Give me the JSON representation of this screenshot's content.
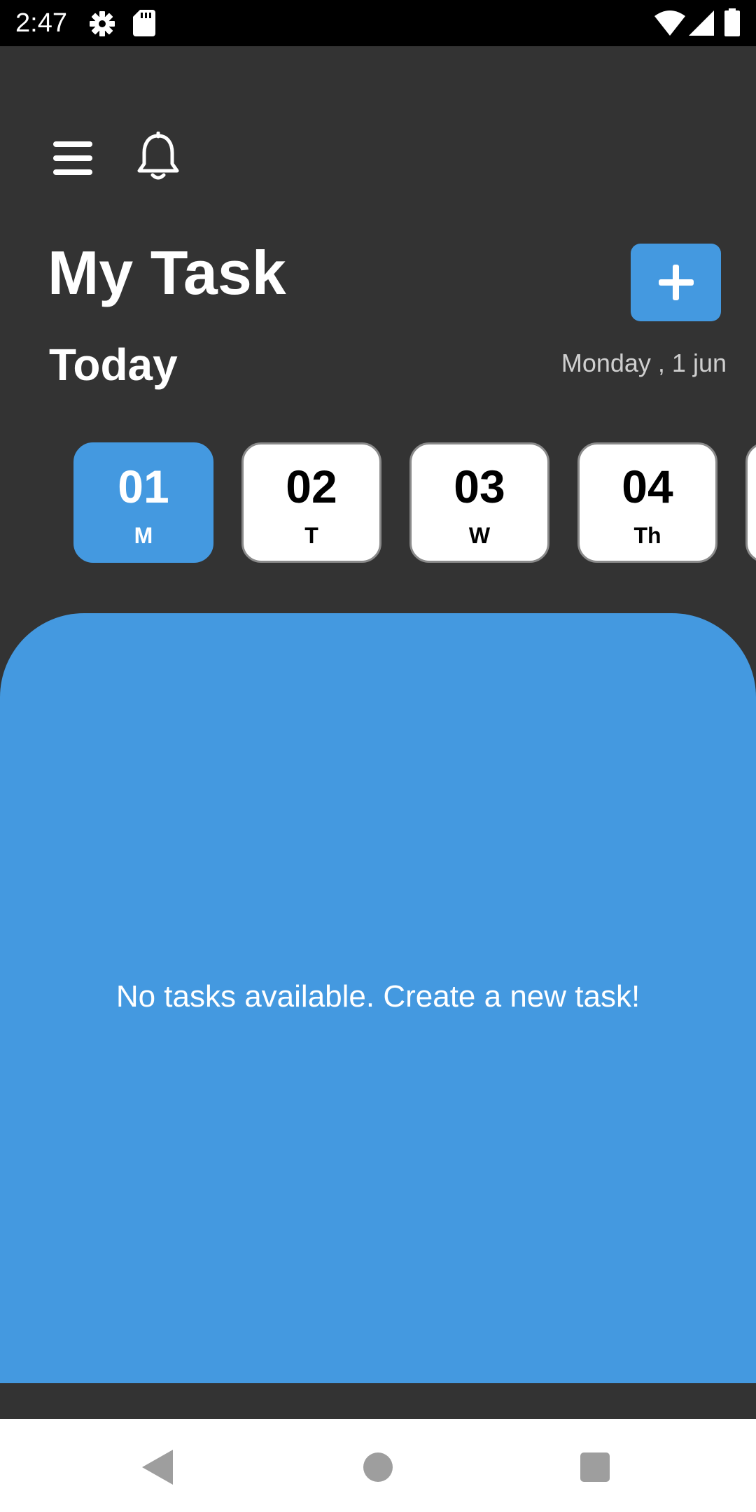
{
  "status_bar": {
    "time": "2:47",
    "icons": [
      "gear-icon",
      "sd-card-icon",
      "wifi-icon",
      "cell-signal-icon",
      "battery-icon"
    ]
  },
  "header": {
    "icons": [
      "menu-icon",
      "bell-icon"
    ]
  },
  "title": "My Task",
  "add_button": {
    "icon": "plus-icon",
    "color": "#4499e0"
  },
  "today_label": "Today",
  "date_label": "Monday , 1 jun",
  "days": [
    {
      "num": "01",
      "letter": "M",
      "selected": true
    },
    {
      "num": "02",
      "letter": "T",
      "selected": false
    },
    {
      "num": "03",
      "letter": "W",
      "selected": false
    },
    {
      "num": "04",
      "letter": "Th",
      "selected": false
    }
  ],
  "empty_message": "No tasks available. Create a new task!",
  "nav_bar": {
    "icons": [
      "back-icon",
      "home-icon",
      "recents-icon"
    ]
  },
  "colors": {
    "background": "#333333",
    "accent": "#4499e0",
    "status_bar": "#000000",
    "nav_bar": "#ffffff"
  }
}
